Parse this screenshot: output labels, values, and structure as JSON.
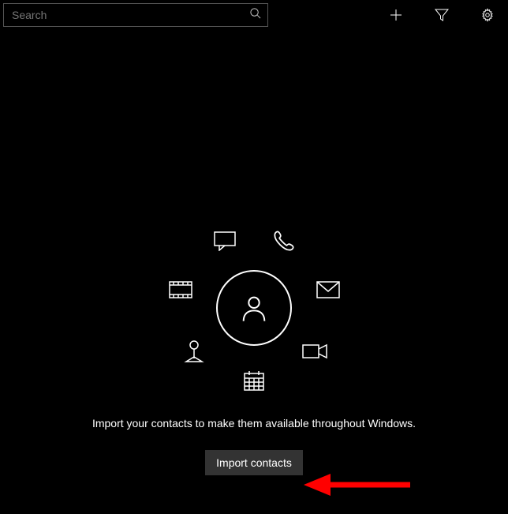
{
  "search": {
    "placeholder": "Search"
  },
  "empty_state": {
    "message": "Import your contacts to make them available throughout Windows.",
    "button_label": "Import contacts"
  }
}
